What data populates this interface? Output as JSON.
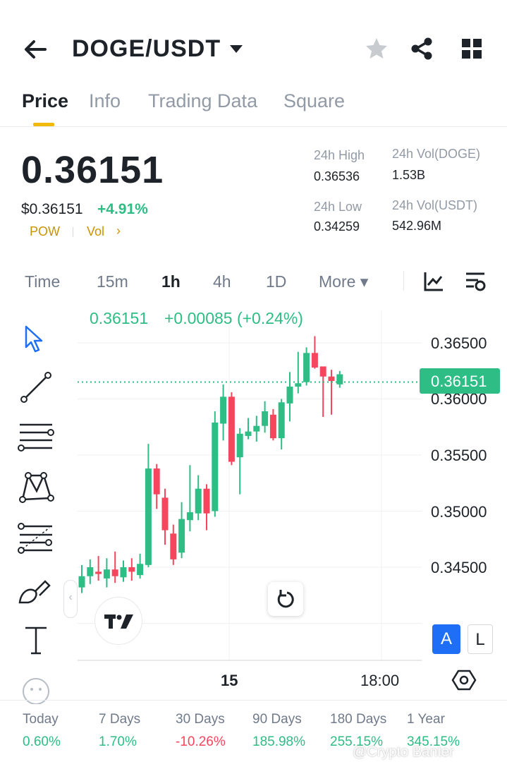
{
  "header": {
    "title": "DOGE/USDT"
  },
  "tabs": [
    {
      "label": "Price"
    },
    {
      "label": "Info"
    },
    {
      "label": "Trading Data"
    },
    {
      "label": "Square"
    }
  ],
  "price": {
    "last": "0.36151",
    "usd": "$0.36151",
    "change_pct": "+4.91%",
    "tag_pow": "POW",
    "tag_vol": "Vol",
    "tag_arrow": "›"
  },
  "stats": {
    "high_label": "24h High",
    "high_value": "0.36536",
    "low_label": "24h Low",
    "low_value": "0.34259",
    "vol_base_label": "24h Vol(DOGE)",
    "vol_base_value": "1.53B",
    "vol_quote_label": "24h Vol(USDT)",
    "vol_quote_value": "542.96M"
  },
  "intervals": [
    {
      "label": "Time"
    },
    {
      "label": "15m"
    },
    {
      "label": "1h"
    },
    {
      "label": "4h"
    },
    {
      "label": "1D"
    },
    {
      "label": "More ▾"
    }
  ],
  "chart_header": {
    "price": "0.36151",
    "change": "+0.00085 (+0.24%)"
  },
  "chart_data": {
    "type": "candlestick",
    "current_price_label": "0.36151",
    "yticks": [
      "0.36500",
      "0.36000",
      "0.35500",
      "0.35000",
      "0.34500"
    ],
    "xticks": [
      "15",
      "18:00"
    ],
    "ylim": [
      0.3428,
      0.366
    ],
    "colors": {
      "up": "#2ebd85",
      "down": "#f6465d"
    },
    "candles": [
      [
        0.3432,
        0.3442,
        0.3452,
        0.3427
      ],
      [
        0.3442,
        0.345,
        0.3457,
        0.3435
      ],
      [
        0.3446,
        0.3444,
        0.346,
        0.3438
      ],
      [
        0.344,
        0.3448,
        0.3458,
        0.3432
      ],
      [
        0.3448,
        0.3442,
        0.3464,
        0.3436
      ],
      [
        0.3441,
        0.345,
        0.3456,
        0.3437
      ],
      [
        0.345,
        0.3446,
        0.3458,
        0.3438
      ],
      [
        0.3443,
        0.3453,
        0.3462,
        0.344
      ],
      [
        0.3452,
        0.3538,
        0.356,
        0.345
      ],
      [
        0.3538,
        0.3515,
        0.3542,
        0.3502
      ],
      [
        0.3512,
        0.3483,
        0.352,
        0.347
      ],
      [
        0.348,
        0.3457,
        0.3488,
        0.3452
      ],
      [
        0.3463,
        0.3493,
        0.3508,
        0.3458
      ],
      [
        0.3492,
        0.3499,
        0.3541,
        0.3482
      ],
      [
        0.3498,
        0.352,
        0.3532,
        0.3492
      ],
      [
        0.352,
        0.3498,
        0.3524,
        0.3483
      ],
      [
        0.35,
        0.3579,
        0.3589,
        0.3495
      ],
      [
        0.3578,
        0.3602,
        0.3613,
        0.3563
      ],
      [
        0.3602,
        0.3544,
        0.3606,
        0.3541
      ],
      [
        0.3548,
        0.3569,
        0.3574,
        0.3515
      ],
      [
        0.3567,
        0.3571,
        0.3583,
        0.3564
      ],
      [
        0.3571,
        0.3576,
        0.3585,
        0.3562
      ],
      [
        0.3576,
        0.3589,
        0.3598,
        0.357
      ],
      [
        0.3586,
        0.3565,
        0.3591,
        0.3563
      ],
      [
        0.3565,
        0.3597,
        0.36,
        0.3555
      ],
      [
        0.3596,
        0.3611,
        0.3624,
        0.358
      ],
      [
        0.3611,
        0.3614,
        0.3642,
        0.3605
      ],
      [
        0.3615,
        0.3641,
        0.3646,
        0.3612
      ],
      [
        0.3641,
        0.3628,
        0.3656,
        0.3627
      ],
      [
        0.3629,
        0.362,
        0.3623,
        0.3584
      ],
      [
        0.362,
        0.3616,
        0.3626,
        0.3586
      ],
      [
        0.3613,
        0.3622,
        0.3625,
        0.361
      ]
    ]
  },
  "chart_controls": {
    "auto_label": "A",
    "log_label": "L",
    "collapse_label": "‹"
  },
  "performance": [
    {
      "label": "Today",
      "value": "0.60%",
      "color": "#2ebd85"
    },
    {
      "label": "7 Days",
      "value": "1.70%",
      "color": "#2ebd85"
    },
    {
      "label": "30 Days",
      "value": "-10.26%",
      "color": "#f6465d"
    },
    {
      "label": "90 Days",
      "value": "185.98%",
      "color": "#2ebd85"
    },
    {
      "label": "180 Days",
      "value": "255.15%",
      "color": "#2ebd85"
    },
    {
      "label": "1 Year",
      "value": "345.15%",
      "color": "#2ebd85"
    }
  ],
  "watermark": "@Crypto Banter",
  "colors": {
    "accent": "#f0b90b",
    "up": "#2ebd85",
    "down": "#f6465d",
    "tool_blue": "#1e6ff5"
  }
}
